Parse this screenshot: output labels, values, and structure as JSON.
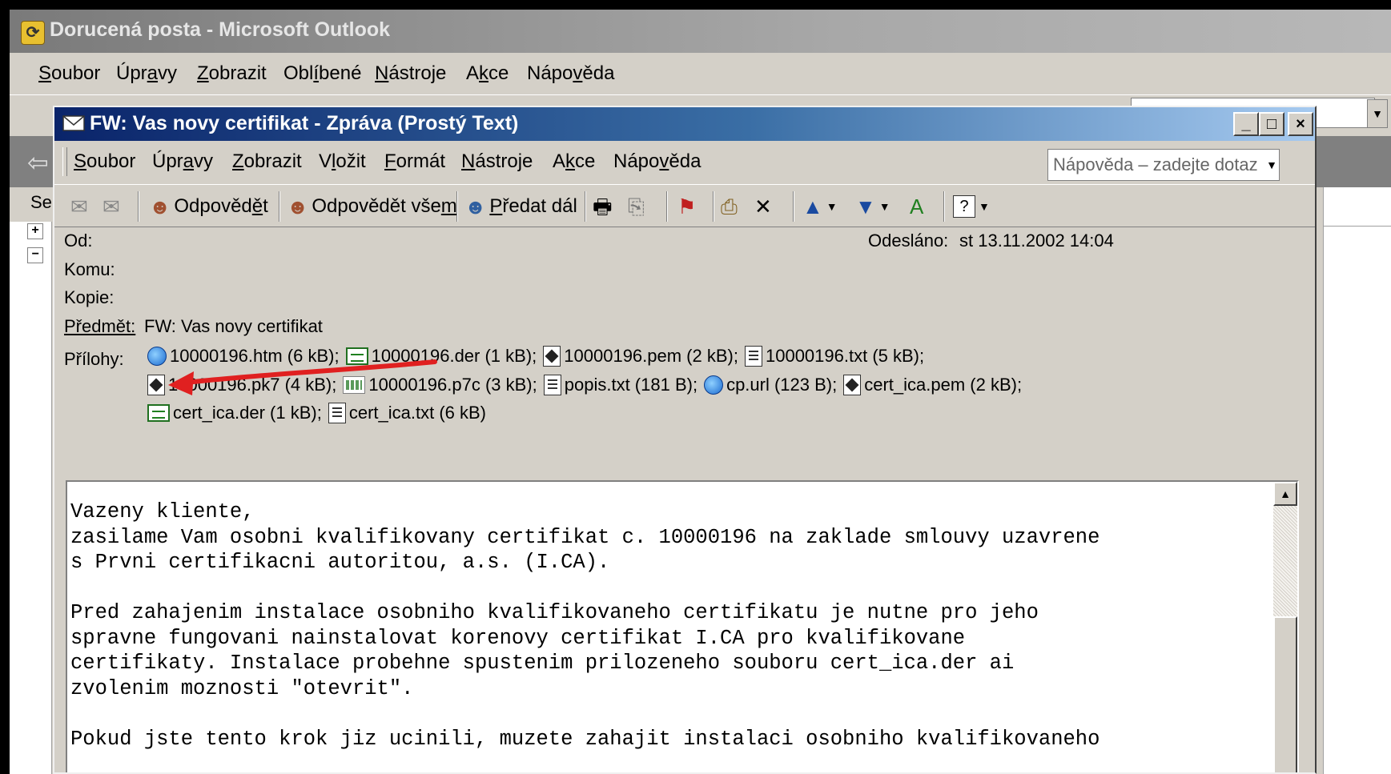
{
  "outlook": {
    "title": "Dorucená posta - Microsoft Outlook",
    "app_icon": "outlook-icon",
    "menu": [
      {
        "pre": "",
        "u": "S",
        "post": "oubor"
      },
      {
        "pre": "Úpr",
        "u": "a",
        "post": "vy"
      },
      {
        "pre": "",
        "u": "Z",
        "post": "obrazit"
      },
      {
        "pre": "Obl",
        "u": "í",
        "post": "bené"
      },
      {
        "pre": "",
        "u": "N",
        "post": "ástroje"
      },
      {
        "pre": "A",
        "u": "k",
        "post": "ce"
      },
      {
        "pre": "Nápo",
        "u": "v",
        "post": "ěda"
      }
    ],
    "find_box": "t.",
    "folder_label": "Se"
  },
  "message": {
    "title": "FW: Vas novy certifikat - Zpráva (Prostý Text)",
    "window_buttons": {
      "minimize": "_",
      "maximize": "□",
      "close": "×"
    },
    "menu": [
      {
        "pre": "",
        "u": "S",
        "post": "oubor"
      },
      {
        "pre": "Úpr",
        "u": "a",
        "post": "vy"
      },
      {
        "pre": "",
        "u": "Z",
        "post": "obrazit"
      },
      {
        "pre": "V",
        "u": "l",
        "post": "ožit"
      },
      {
        "pre": "",
        "u": "F",
        "post": "ormát"
      },
      {
        "pre": "",
        "u": "N",
        "post": "ástroje"
      },
      {
        "pre": "A",
        "u": "k",
        "post": "ce"
      },
      {
        "pre": "Nápo",
        "u": "v",
        "post": "ěda"
      }
    ],
    "help_placeholder": "Nápověda – zadejte dotaz",
    "toolbar": {
      "reply": {
        "pre": "Odpověd",
        "u": "ě",
        "post": "t"
      },
      "reply_all": {
        "pre": "Odpovědět vše",
        "u": "m",
        "post": ""
      },
      "forward": {
        "pre": "",
        "u": "P",
        "post": "ředat dál"
      }
    },
    "header": {
      "from_label": "Od:",
      "from_value": "",
      "sent_label": "Odesláno:",
      "sent_value": "st 13.11.2002 14:04",
      "to_label": "Komu:",
      "cc_label": "Kopie:",
      "subject_label": "Předmět:",
      "subject_value": "FW: Vas novy certifikat",
      "attachments_label": "Přílohy:"
    },
    "attachments": [
      [
        {
          "icon": "ie-icon",
          "text": "10000196.htm (6 kB);"
        },
        {
          "icon": "certificate-icon",
          "text": "10000196.der (1 kB);"
        },
        {
          "icon": "pem-file-icon",
          "text": "10000196.pem (2 kB);"
        },
        {
          "icon": "text-file-icon",
          "text": "10000196.txt (5 kB);"
        }
      ],
      [
        {
          "icon": "pem-file-icon",
          "text": "10000196.pk7 (4 kB);"
        },
        {
          "icon": "p7c-file-icon",
          "text": "10000196.p7c (3 kB);"
        },
        {
          "icon": "text-file-icon",
          "text": "popis.txt (181 B);"
        },
        {
          "icon": "ie-icon",
          "text": "cp.url (123 B);"
        },
        {
          "icon": "pem-file-icon",
          "text": "cert_ica.pem (2 kB);"
        }
      ],
      [
        {
          "icon": "certificate-icon",
          "text": "cert_ica.der (1 kB);"
        },
        {
          "icon": "text-file-icon",
          "text": "cert_ica.txt (6 kB)"
        }
      ]
    ],
    "body": "Vazeny kliente,\nzasilame Vam osobni kvalifikovany certifikat c. 10000196 na zaklade smlouvy uzavrene\ns Prvni certifikacni autoritou, a.s. (I.CA).\n\nPred zahajenim instalace osobniho kvalifikovaneho certifikatu je nutne pro jeho\nspravne fungovani nainstalovat korenovy certifikat I.CA pro kvalifikovane\ncertifikaty. Instalace probehne spustenim prilozeneho souboru cert_ica.der ai\nzvolenim moznosti \"otevrit\".\n\nPokud jste tento krok jiz ucinili, muzete zahajit instalaci osobniho kvalifikovaneho"
  },
  "annotation": {
    "color": "#e02020"
  }
}
